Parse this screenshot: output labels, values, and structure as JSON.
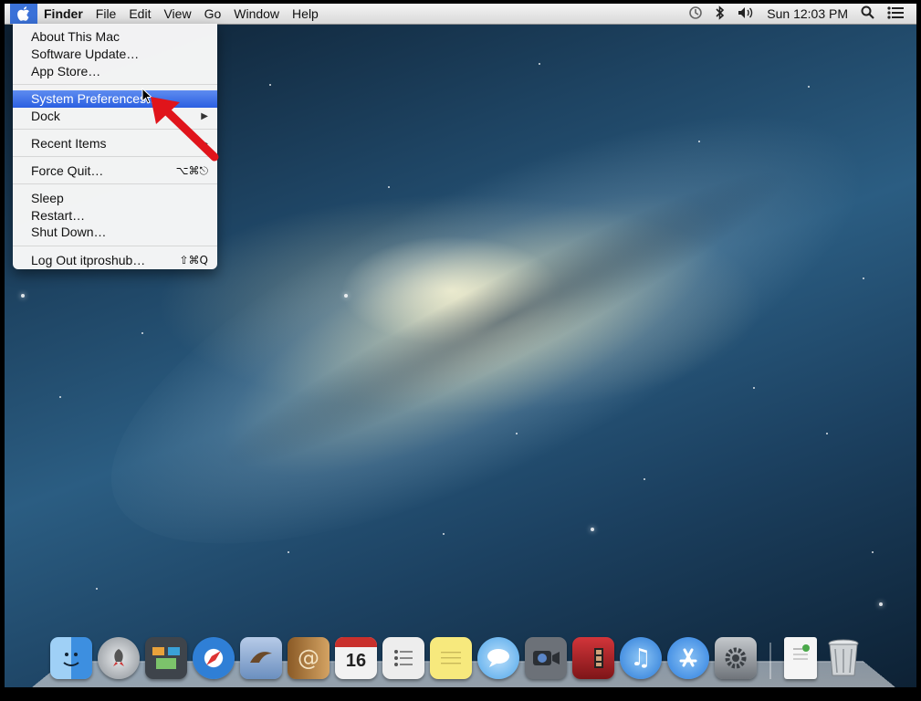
{
  "menubar": {
    "apple_icon": "apple-logo-icon",
    "app_name": "Finder",
    "menus": [
      "File",
      "Edit",
      "View",
      "Go",
      "Window",
      "Help"
    ],
    "status": {
      "time_machine_icon": "time-machine-icon",
      "bluetooth_icon": "bluetooth-icon",
      "volume_icon": "volume-icon",
      "clock": "Sun 12:03 PM",
      "spotlight_icon": "spotlight-search-icon",
      "notification_icon": "notification-center-icon"
    }
  },
  "apple_menu": {
    "items": [
      {
        "label": "About This Mac"
      },
      {
        "label": "Software Update…"
      },
      {
        "label": "App Store…"
      },
      {
        "label": "System Preferences…",
        "highlighted": true
      },
      {
        "label": "Dock",
        "submenu": true
      },
      {
        "label": "Recent Items",
        "submenu": true
      },
      {
        "label": "Force Quit…",
        "shortcut": "⌥⌘⎋"
      },
      {
        "label": "Sleep"
      },
      {
        "label": "Restart…"
      },
      {
        "label": "Shut Down…"
      },
      {
        "label": "Log Out itproshub…",
        "shortcut": "⇧⌘Q"
      }
    ]
  },
  "dock": {
    "items": [
      {
        "name": "finder-icon",
        "color": "#3d8fe0"
      },
      {
        "name": "launchpad-icon",
        "color": "#9aa0a6"
      },
      {
        "name": "mission-control-icon",
        "color": "#4a5057"
      },
      {
        "name": "safari-icon",
        "color": "#2f7fd6"
      },
      {
        "name": "mail-icon",
        "color": "#6b8fbf"
      },
      {
        "name": "contacts-icon",
        "color": "#c08a4a"
      },
      {
        "name": "calendar-icon",
        "color": "#f2f2f2",
        "text": "16"
      },
      {
        "name": "reminders-icon",
        "color": "#ededed"
      },
      {
        "name": "notes-icon",
        "color": "#f7e97d"
      },
      {
        "name": "messages-icon",
        "color": "#4fa6ea"
      },
      {
        "name": "facetime-icon",
        "color": "#6c7178"
      },
      {
        "name": "photo-booth-icon",
        "color": "#b2252a"
      },
      {
        "name": "itunes-icon",
        "color": "#2a7ad8"
      },
      {
        "name": "app-store-icon",
        "color": "#2d7fe0"
      },
      {
        "name": "system-preferences-icon",
        "color": "#8d9298"
      },
      {
        "name": "document-stack-icon",
        "color": "#f5f5f5"
      },
      {
        "name": "trash-icon",
        "color": "#cfd3d6"
      }
    ]
  }
}
